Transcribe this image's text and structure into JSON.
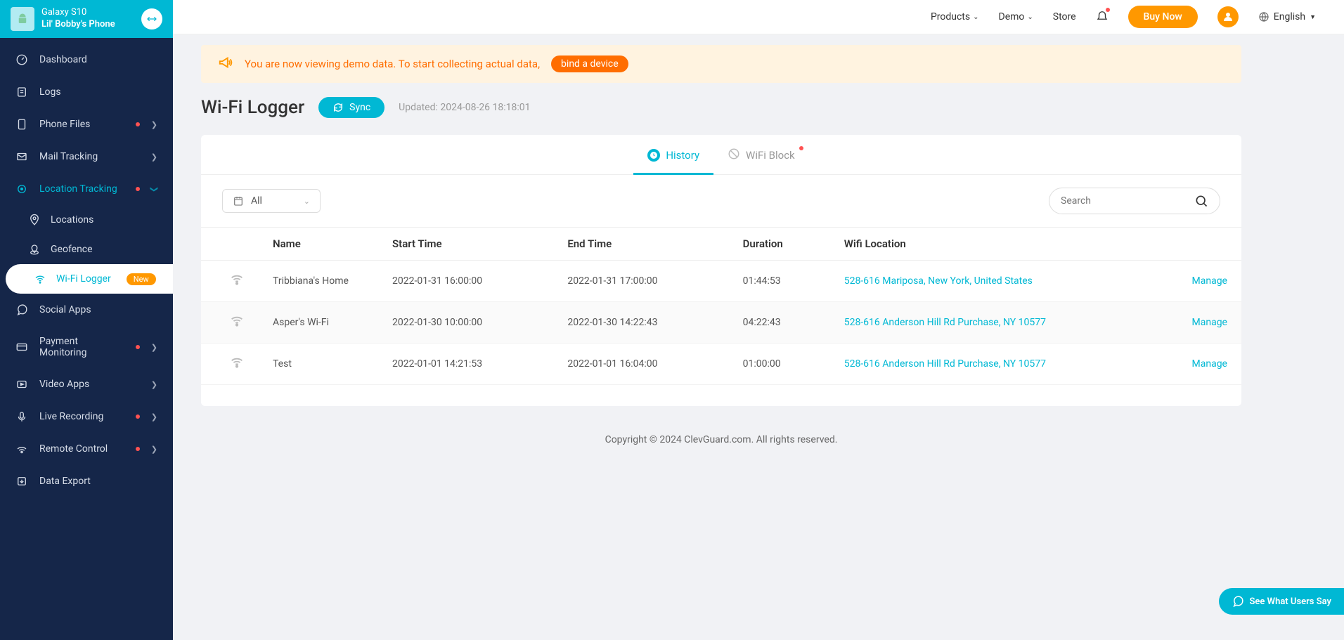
{
  "device": {
    "model": "Galaxy S10",
    "name": "Lil' Bobby's Phone"
  },
  "sidebar": {
    "dashboard": "Dashboard",
    "logs": "Logs",
    "phone_files": "Phone Files",
    "mail_tracking": "Mail Tracking",
    "location_tracking": "Location Tracking",
    "locations": "Locations",
    "geofence": "Geofence",
    "wifi_logger": "Wi-Fi Logger",
    "wifi_badge": "New",
    "social_apps": "Social Apps",
    "payment_monitoring": "Payment Monitoring",
    "video_apps": "Video Apps",
    "live_recording": "Live Recording",
    "remote_control": "Remote Control",
    "data_export": "Data Export"
  },
  "topnav": {
    "products": "Products",
    "demo": "Demo",
    "store": "Store",
    "buy_now": "Buy Now",
    "language": "English"
  },
  "banner": {
    "text": "You are now viewing demo data. To start collecting actual data,",
    "cta": "bind a device"
  },
  "page": {
    "title": "Wi-Fi Logger",
    "sync": "Sync",
    "updated": "Updated: 2024-08-26 18:18:01"
  },
  "tabs": {
    "history": "History",
    "wifi_block": "WiFi Block"
  },
  "filter": {
    "all": "All",
    "search_placeholder": "Search"
  },
  "table": {
    "headers": {
      "name": "Name",
      "start": "Start Time",
      "end": "End Time",
      "duration": "Duration",
      "location": "Wifi Location"
    },
    "manage": "Manage",
    "rows": [
      {
        "name": "Tribbiana's Home",
        "start": "2022-01-31 16:00:00",
        "end": "2022-01-31 17:00:00",
        "duration": "01:44:53",
        "location": "528-616 Mariposa, New York, United States"
      },
      {
        "name": "Asper's Wi-Fi",
        "start": "2022-01-30 10:00:00",
        "end": "2022-01-30 14:22:43",
        "duration": "04:22:43",
        "location": "528-616 Anderson Hill Rd Purchase, NY 10577"
      },
      {
        "name": "Test",
        "start": "2022-01-01 14:21:53",
        "end": "2022-01-01 16:04:00",
        "duration": "01:00:00",
        "location": "528-616 Anderson Hill Rd Purchase, NY 10577"
      }
    ]
  },
  "footer": "Copyright © 2024 ClevGuard.com. All rights reserved.",
  "feedback": "See What Users Say"
}
